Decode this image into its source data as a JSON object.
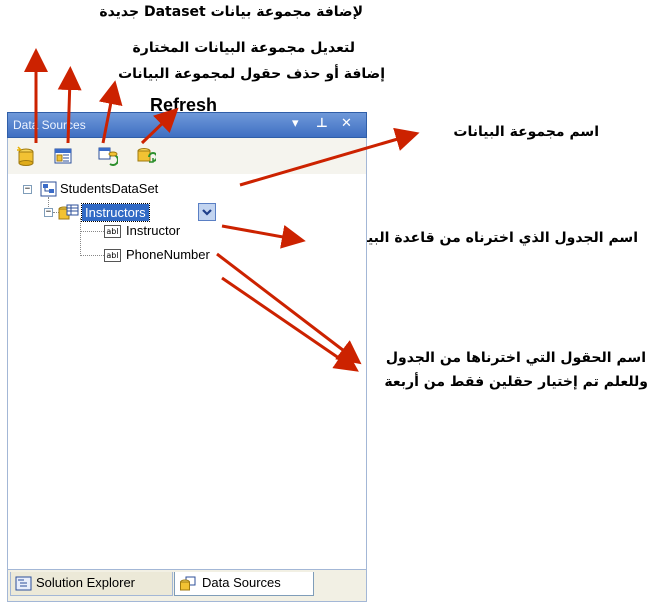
{
  "annotations": {
    "add_dataset": "لإضافة مجموعة بيانات Dataset جديدة",
    "edit_dataset": "لتعديل مجموعة البيانات المختارة",
    "add_remove_fields": "إضافة أو حذف حقول لمجموعة البيانات",
    "refresh": "Refresh",
    "dataset_name": "اسم مجموعة البيانات",
    "table_name": "اسم الجدول الذي اخترناه من قاعدة البيانات",
    "fields_line1": "اسم الحقول التي اخترناها من الجدول",
    "fields_line2": "وللعلم تم إختيار حقلين فقط من أربعة"
  },
  "panel": {
    "title": "Data Sources",
    "pin_glyph": "▾ ᵃ",
    "close_glyph": "✕"
  },
  "tree": {
    "dataset": "StudentsDataSet",
    "table": "Instructors",
    "fields": [
      {
        "icon_text": "abl",
        "label": "Instructor"
      },
      {
        "icon_text": "abl",
        "label": "PhoneNumber"
      }
    ]
  },
  "tabs": [
    {
      "label": "Solution Explorer"
    },
    {
      "label": "Data Sources"
    }
  ],
  "colors": {
    "accent": "#cc2200",
    "title_bar": "#4f7fcf",
    "selection": "#316ac5"
  }
}
